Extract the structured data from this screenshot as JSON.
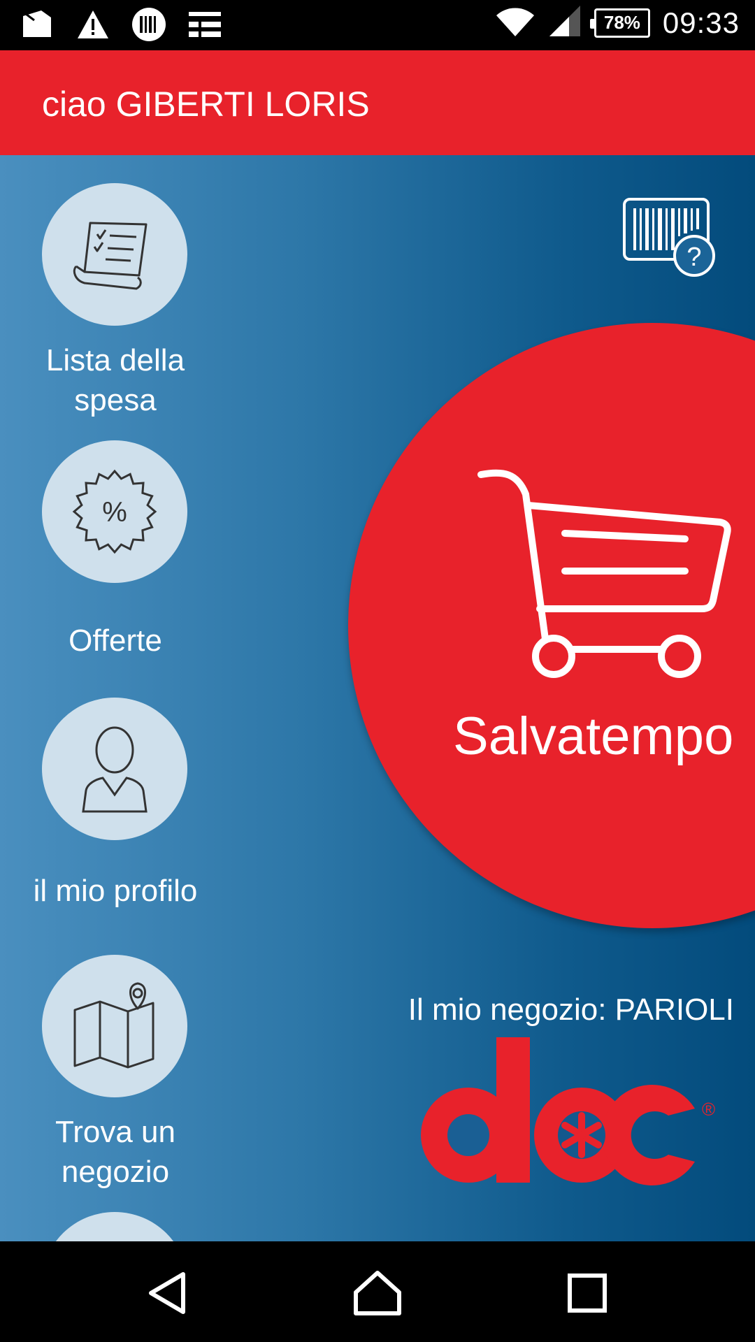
{
  "status_bar": {
    "left_icons": [
      "gallery-notification-icon",
      "warning-icon",
      "barcode-circle-icon",
      "news-icon"
    ],
    "right_icons": [
      "wifi-icon",
      "cell-signal-icon"
    ],
    "battery": "78%",
    "time": "09:33"
  },
  "header": {
    "greeting": "ciao GIBERTI LORIS"
  },
  "menu": {
    "items": [
      {
        "icon": "shopping-list-icon",
        "label_line1": "Lista della",
        "label_line2": "spesa"
      },
      {
        "icon": "offer-badge-icon",
        "label_line1": "Offerte",
        "label_line2": ""
      },
      {
        "icon": "profile-icon",
        "label_line1": "il mio profilo",
        "label_line2": ""
      },
      {
        "icon": "store-map-icon",
        "label_line1": "Trova un",
        "label_line2": "negozio"
      }
    ]
  },
  "main": {
    "cart_label": "Salvatempo",
    "store_line": "Il mio negozio: PARIOLI",
    "logo_text": "doc",
    "logo_mark": "®"
  },
  "colors": {
    "brand_red": "#e8222b",
    "gradient_left": "#4a8fbf",
    "gradient_right": "#034b7c",
    "circle_bg": "#cfe0ec"
  },
  "nav_bar": {
    "buttons": [
      "back-icon",
      "home-icon",
      "recents-icon"
    ]
  }
}
